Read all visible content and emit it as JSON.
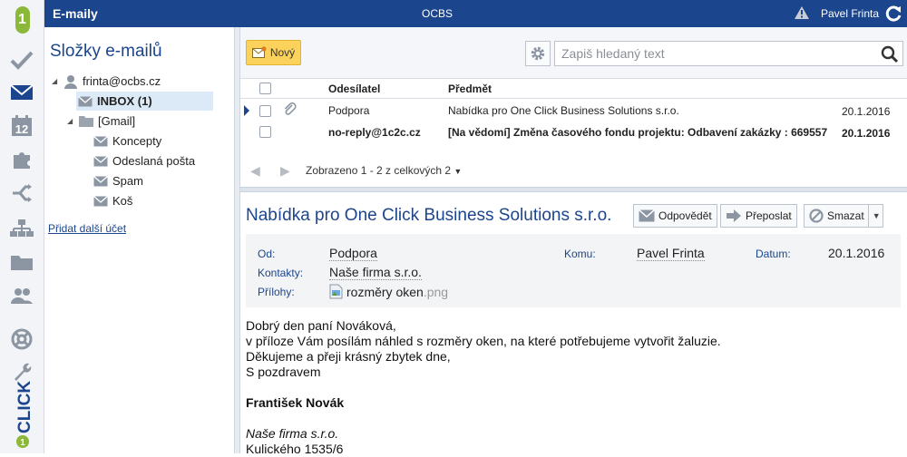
{
  "topbar": {
    "app_title": "E-maily",
    "org_name": "OCBS",
    "user_name": "Pavel Frinta"
  },
  "rail": {
    "icons": [
      "checkmark-icon",
      "envelope-icon",
      "calendar-icon",
      "puzzle-icon",
      "split-arrows-icon",
      "org-chart-icon",
      "folder-icon",
      "people-icon",
      "lifebuoy-icon",
      "wrench-icon"
    ],
    "calendar_number": "12",
    "logo_text": "1",
    "brand_text": "CLICK",
    "brand_digit": "1"
  },
  "folders": {
    "title": "Složky e-mailů",
    "account": "frinta@ocbs.cz",
    "inbox": "INBOX (1)",
    "gmail": "[Gmail]",
    "items": [
      "Koncepty",
      "Odeslaná pošta",
      "Spam",
      "Koš"
    ],
    "add_account": "Přidat další účet"
  },
  "toolbar": {
    "new_label": "Nový",
    "search_placeholder": "Zapiš hledaný text"
  },
  "list": {
    "columns": {
      "sender": "Odesílatel",
      "subject": "Předmět"
    },
    "rows": [
      {
        "sender": "Podpora",
        "subject": "Nabídka pro One Click Business Solutions s.r.o.",
        "date": "20.1.2016",
        "has_attachment": true,
        "unread": false,
        "selected": true
      },
      {
        "sender": "no-reply@1c2c.cz",
        "subject": "[Na vědomí] Změna časového fondu projektu: Odbavení zakázky : 669557",
        "date": "20.1.2016",
        "has_attachment": false,
        "unread": true,
        "selected": false
      }
    ],
    "pager_info": "Zobrazeno 1 - 2 z celkových 2"
  },
  "message": {
    "title": "Nabídka pro One Click Business Solutions s.r.o.",
    "actions": {
      "reply": "Odpovědět",
      "forward": "Přeposlat",
      "delete": "Smazat"
    },
    "meta": {
      "from_label": "Od:",
      "from": "Podpora",
      "to_label": "Komu:",
      "to": "Pavel Frinta",
      "date_label": "Datum:",
      "date": "20.1.2016",
      "contacts_label": "Kontakty:",
      "contacts": "Naše firma s.r.o.",
      "attachments_label": "Přílohy:",
      "attachment_name": "rozměry oken",
      "attachment_ext": ".png"
    },
    "body": {
      "line1": "Dobrý den paní Nováková,",
      "line2": "v příloze Vám posílám náhled s rozměry oken, na které potřebujeme vytvořit žaluzie.",
      "line3": "Děkujeme a přeji krásný zbytek dne,",
      "line4": "S pozdravem",
      "signature_name": "František Novák",
      "signature_company": "Naše firma s.r.o.",
      "signature_street": "Kulického 1535/6"
    }
  },
  "colors": {
    "brand_blue": "#1b458d",
    "accent_yellow": "#fbd35c",
    "logo_green": "#8cb83a"
  }
}
